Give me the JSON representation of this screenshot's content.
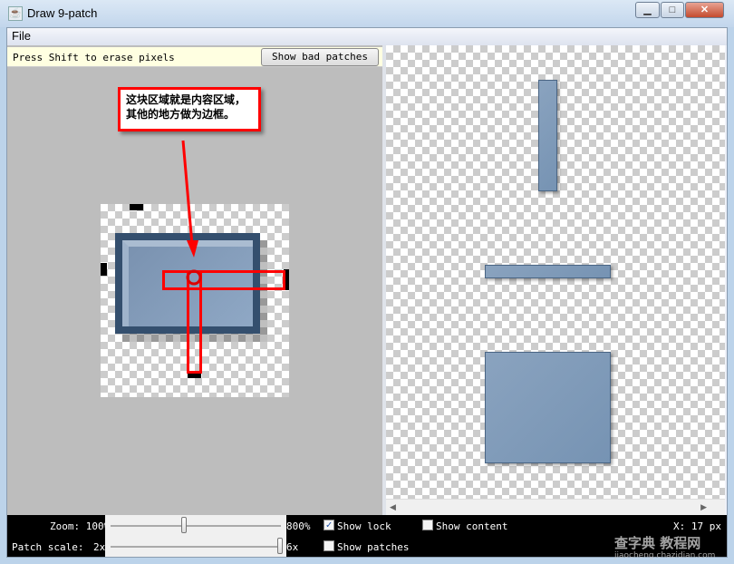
{
  "window": {
    "title": "Draw 9-patch",
    "controls": {
      "minimize": "▁",
      "maximize": "□",
      "close": "✕"
    }
  },
  "menu": {
    "file": "File"
  },
  "toolbar": {
    "hint": "Press Shift to erase pixels",
    "bad_patches_label": "Show bad patches"
  },
  "annotation": {
    "line1": "这块区域就是内容区域，",
    "line2": "其他的地方做为边框。",
    "color": "#ff0000"
  },
  "bottom": {
    "zoom_label": "Zoom: 100%",
    "zoom_max": "800%",
    "zoom_level_fraction": 0.43,
    "patch_scale_label": "Patch scale:",
    "patch_min": "2x",
    "patch_max": "6x",
    "patch_scale_fraction": 1.0,
    "show_lock": {
      "label": "Show lock",
      "checked": true
    },
    "show_content": {
      "label": "Show content",
      "checked": false
    },
    "show_patches": {
      "label": "Show patches",
      "checked": false
    },
    "x_readout": "X: 17 px"
  },
  "watermark": {
    "line1": "查字典 教程网",
    "line2": "jiaocheng.chazidian.com"
  }
}
